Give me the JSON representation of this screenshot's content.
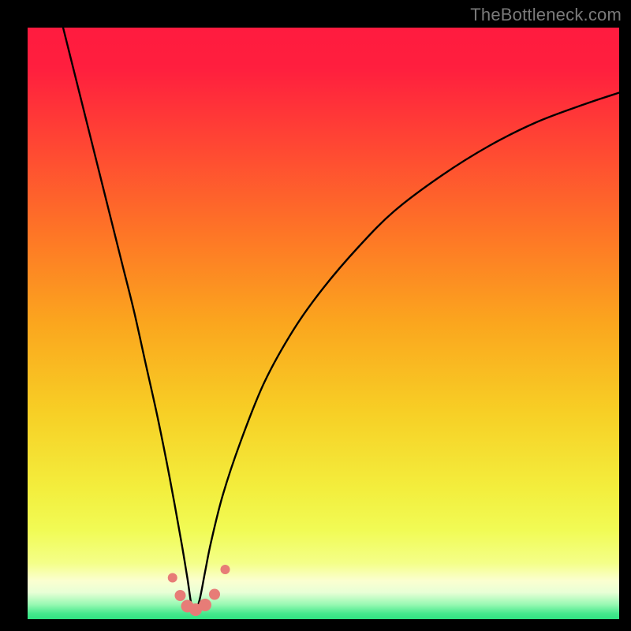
{
  "watermark": "TheBottleneck.com",
  "colors": {
    "black": "#000000",
    "curve": "#000000",
    "dot": "#e77c77",
    "gradient_stops": [
      {
        "offset": 0.0,
        "color": "#ff1b3f"
      },
      {
        "offset": 0.07,
        "color": "#ff1f3e"
      },
      {
        "offset": 0.2,
        "color": "#ff4733"
      },
      {
        "offset": 0.35,
        "color": "#fe7626"
      },
      {
        "offset": 0.5,
        "color": "#fba61e"
      },
      {
        "offset": 0.65,
        "color": "#f7cf25"
      },
      {
        "offset": 0.78,
        "color": "#f3ee3d"
      },
      {
        "offset": 0.85,
        "color": "#f1fb55"
      },
      {
        "offset": 0.905,
        "color": "#f4ff88"
      },
      {
        "offset": 0.935,
        "color": "#fbffd0"
      },
      {
        "offset": 0.955,
        "color": "#e8ffd6"
      },
      {
        "offset": 0.975,
        "color": "#99f9b3"
      },
      {
        "offset": 0.99,
        "color": "#47e98e"
      },
      {
        "offset": 1.0,
        "color": "#2fe281"
      }
    ]
  },
  "chart_data": {
    "type": "line",
    "title": "",
    "xlabel": "",
    "ylabel": "",
    "xlim": [
      0,
      100
    ],
    "ylim": [
      0,
      100
    ],
    "note": "V-shaped bottleneck curve; minimum at x≈28. Y represents mismatch (%); background hue encodes severity (red high → green low).",
    "series": [
      {
        "name": "bottleneck-curve",
        "x": [
          6,
          8,
          10,
          12,
          14,
          16,
          18,
          20,
          22,
          24,
          26,
          27,
          28,
          29,
          30,
          31,
          33,
          36,
          40,
          45,
          50,
          56,
          62,
          70,
          78,
          86,
          94,
          100
        ],
        "y": [
          100,
          92,
          84,
          76,
          68,
          60,
          52,
          43,
          34,
          24,
          13,
          7,
          1,
          3,
          8,
          13,
          21,
          30,
          40,
          49,
          56,
          63,
          69,
          75,
          80,
          84,
          87,
          89
        ]
      }
    ],
    "markers": {
      "name": "highlight-dots",
      "x": [
        24.5,
        25.8,
        27.0,
        28.4,
        30.0,
        31.6,
        33.4
      ],
      "y": [
        7.0,
        4.0,
        2.2,
        1.6,
        2.4,
        4.2,
        8.4
      ],
      "r": [
        6,
        7,
        8,
        8,
        8,
        7,
        6
      ]
    }
  }
}
